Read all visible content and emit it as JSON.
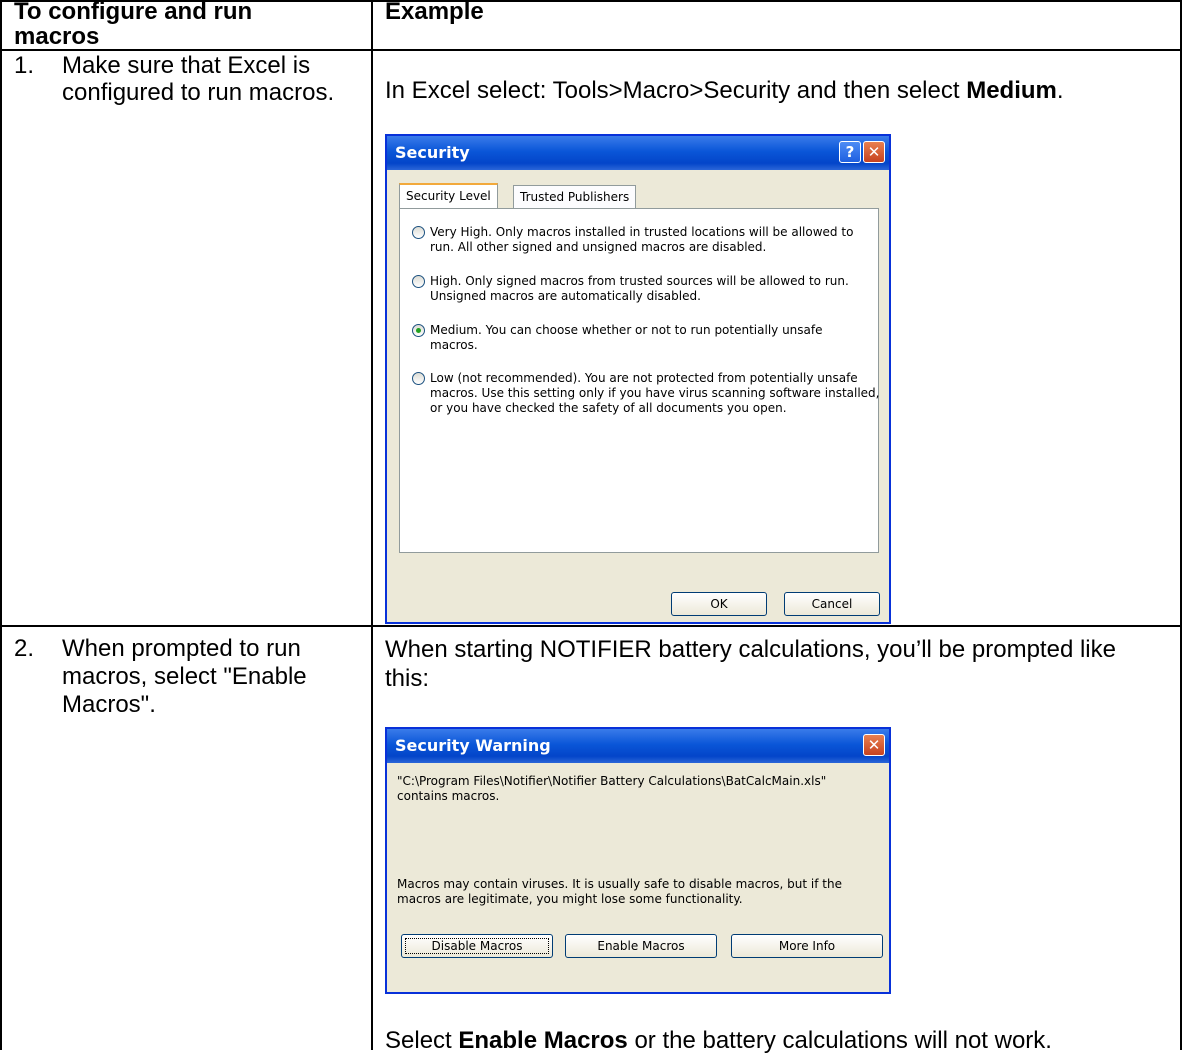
{
  "table": {
    "header_left": "To configure and run macros",
    "header_right": "Example"
  },
  "rows": [
    {
      "number": "1.",
      "instruction": "Make sure that Excel is configured to run macros.",
      "example_prefix": "In Excel select: Tools>Macro>Security and then select ",
      "example_bold": "Medium",
      "example_suffix": "."
    },
    {
      "number": "2.",
      "instruction": "When prompted to run macros, select \"Enable Macros\".",
      "example_text": "When starting NOTIFIER battery calculations, you’ll be prompted like this:",
      "footer_prefix": "Select ",
      "footer_bold": "Enable Macros",
      "footer_suffix": " or the battery calculations will not work."
    }
  ],
  "security_dialog": {
    "title": "Security",
    "help_glyph": "?",
    "close_glyph": "✕",
    "tabs": [
      "Security Level",
      "Trusted Publishers"
    ],
    "options": [
      {
        "label": "Very High. Only macros installed in trusted locations will be allowed to run. All other signed and unsigned macros are disabled.",
        "checked": false
      },
      {
        "label": "High. Only signed macros from trusted sources will be allowed to run. Unsigned macros are automatically disabled.",
        "checked": false
      },
      {
        "label": "Medium. You can choose whether or not to run potentially unsafe macros.",
        "checked": true
      },
      {
        "label": "Low (not recommended). You are not protected from potentially unsafe macros. Use this setting only if you have virus scanning software installed, or you have checked the safety of all documents you open.",
        "checked": false
      }
    ],
    "ok_label": "OK",
    "cancel_label": "Cancel"
  },
  "warning_dialog": {
    "title": "Security Warning",
    "close_glyph": "✕",
    "path_text": "\"C:\\Program Files\\Notifier\\Notifier Battery Calculations\\BatCalcMain.xls\" contains macros.",
    "info_text": "Macros may contain viruses. It is usually safe to disable macros, but if the macros are legitimate, you might lose some functionality.",
    "disable_label": "Disable Macros",
    "enable_label": "Enable Macros",
    "more_info_label": "More Info"
  }
}
